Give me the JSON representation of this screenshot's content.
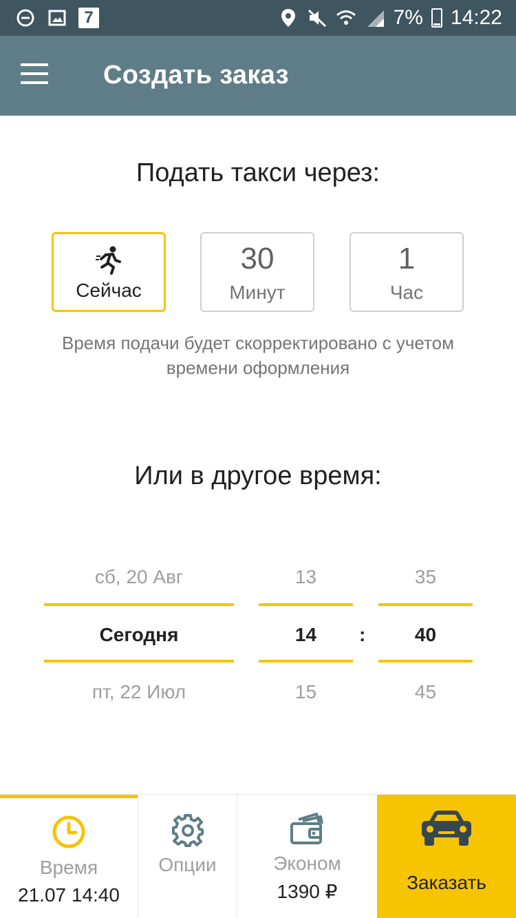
{
  "status_bar": {
    "battery": "7%",
    "time": "14:22",
    "calendar_day": "7"
  },
  "app_bar": {
    "title": "Создать заказ"
  },
  "pickup": {
    "title": "Подать такси через:",
    "options": [
      {
        "value": "",
        "label": "Сейчас",
        "selected": true
      },
      {
        "value": "30",
        "label": "Минут",
        "selected": false
      },
      {
        "value": "1",
        "label": "Час",
        "selected": false
      }
    ],
    "hint": "Время подачи будет скорректировано с учетом времени оформления"
  },
  "other_time": {
    "title": "Или в другое время:",
    "date": {
      "prev": "сб, 20 Авг",
      "current": "Сегодня",
      "next": "пт, 22 Июл"
    },
    "hour": {
      "prev": "13",
      "current": "14",
      "next": "15"
    },
    "minute": {
      "prev": "35",
      "current": "40",
      "next": "45"
    },
    "separator": ":"
  },
  "bottom_bar": {
    "time_label": "Время",
    "time_value": "21.07 14:40",
    "options_label": "Опции",
    "tariff_label": "Эконом",
    "tariff_price": "1390 ₽",
    "order_label": "Заказать"
  },
  "colors": {
    "accent": "#f6c400",
    "app_bar": "#5f7d88",
    "status_bar": "#3f5560"
  },
  "icons": {
    "menu": "menu-icon",
    "now": "runner-icon",
    "time": "clock-icon",
    "options": "gear-icon",
    "tariff": "wallet-icon",
    "order": "car-icon"
  }
}
